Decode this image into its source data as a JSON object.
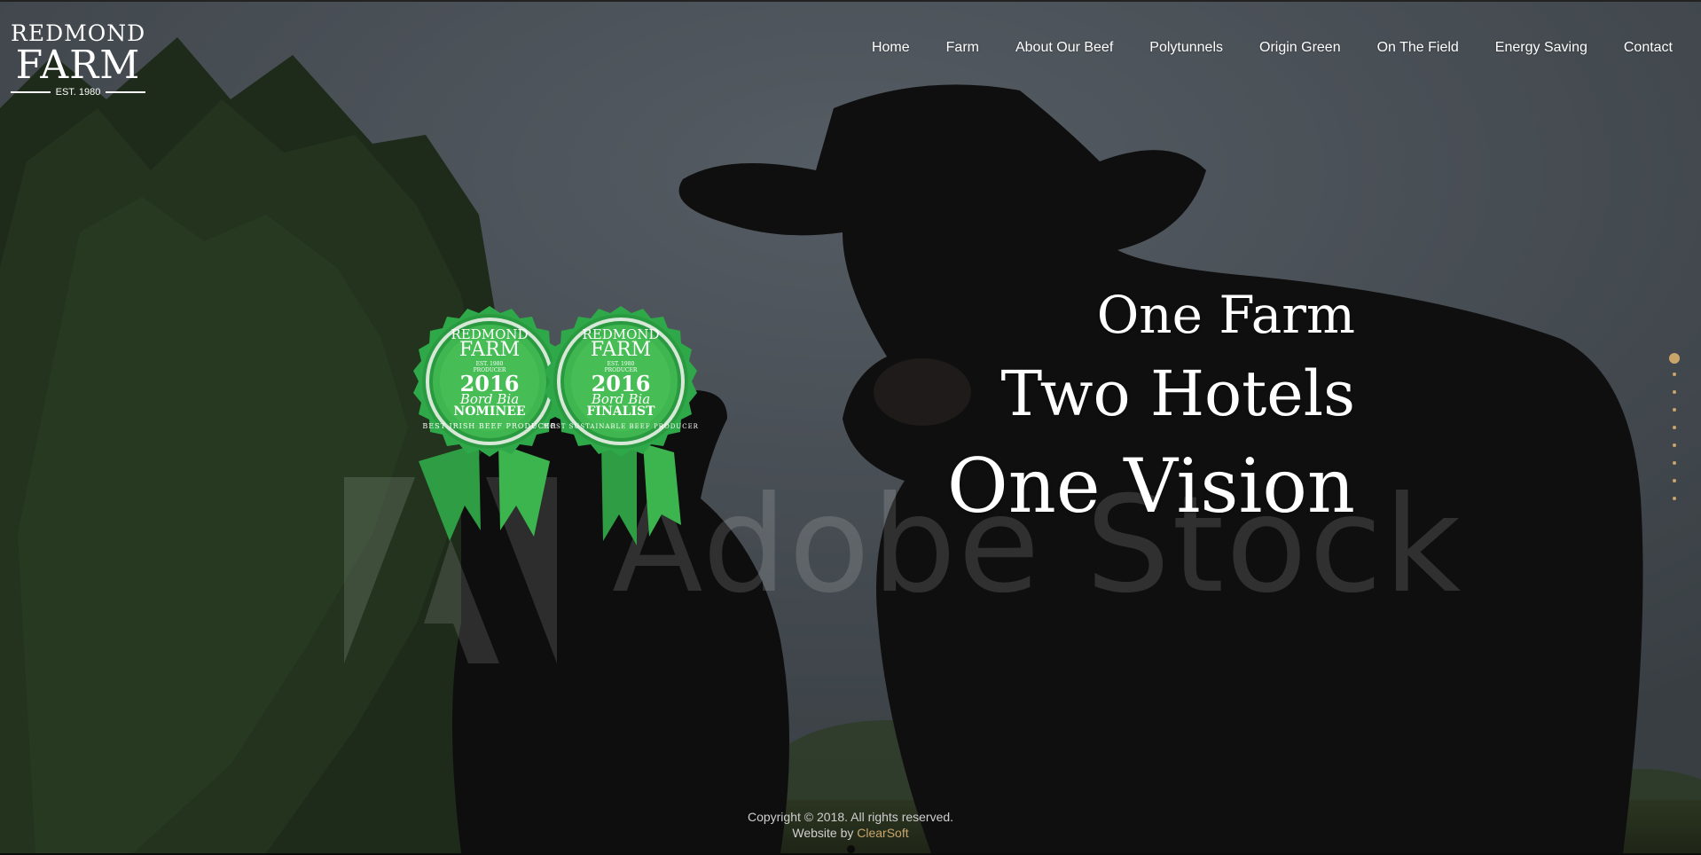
{
  "logo": {
    "line1": "REDMOND",
    "line2": "FARM",
    "est": "EST. 1980",
    "icon": "redmond-farm-logo"
  },
  "nav": {
    "items": [
      "Home",
      "Farm",
      "About Our Beef",
      "Polytunnels",
      "Origin Green",
      "On The Field",
      "Energy Saving",
      "Contact"
    ]
  },
  "hero": {
    "line1": "One Farm",
    "line2": "Two Hotels",
    "line3": "One Vision",
    "watermark": "Adobe Stock"
  },
  "badges": [
    {
      "farm1": "REDMOND",
      "farm2": "FARM",
      "small": "EST. 1980",
      "producer": "PRODUCER",
      "year": "2016",
      "brand": "Bord Bia",
      "status": "NOMINEE",
      "ring_text": "BEST IRISH BEEF PRODUCER",
      "icon": "award-rosette-icon"
    },
    {
      "farm1": "REDMOND",
      "farm2": "FARM",
      "small": "EST. 1980",
      "producer": "PRODUCER",
      "year": "2016",
      "brand": "Bord Bia",
      "status": "FINALIST",
      "ring_text": "MOST SUSTAINABLE BEEF PRODUCER",
      "icon": "award-rosette-icon"
    }
  ],
  "slider": {
    "slide_count": 9,
    "active_index": 0,
    "color": "#c9a56a"
  },
  "footer": {
    "copyright": "Copyright © 2018. All rights reserved.",
    "credit_prefix": "Website by ",
    "credit_link": "ClearSoft"
  },
  "colors": {
    "accent": "#c9a56a",
    "badge_green": "#2fa84a",
    "badge_light": "#6fd07a"
  }
}
